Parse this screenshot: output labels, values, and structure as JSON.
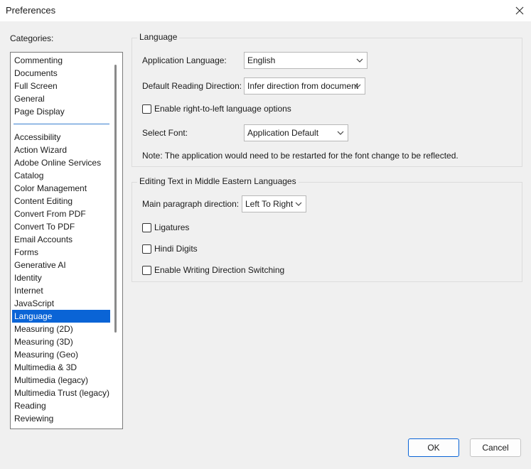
{
  "window": {
    "title": "Preferences"
  },
  "categories": {
    "label": "Categories:",
    "top_group": [
      "Commenting",
      "Documents",
      "Full Screen",
      "General",
      "Page Display"
    ],
    "items": [
      "Accessibility",
      "Action Wizard",
      "Adobe Online Services",
      "Catalog",
      "Color Management",
      "Content Editing",
      "Convert From PDF",
      "Convert To PDF",
      "Email Accounts",
      "Forms",
      "Generative AI",
      "Identity",
      "Internet",
      "JavaScript",
      "Language",
      "Measuring (2D)",
      "Measuring (3D)",
      "Measuring (Geo)",
      "Multimedia & 3D",
      "Multimedia (legacy)",
      "Multimedia Trust (legacy)",
      "Reading",
      "Reviewing"
    ],
    "selected": "Language"
  },
  "language_group": {
    "title": "Language",
    "app_language_label": "Application Language:",
    "app_language_value": "English",
    "reading_direction_label": "Default Reading Direction:",
    "reading_direction_value": "Infer direction from document",
    "rtl_checkbox_label": "Enable right-to-left language options",
    "rtl_checked": false,
    "font_label": "Select Font:",
    "font_value": "Application Default",
    "note": "Note: The application would need to be restarted for the font change to be reflected."
  },
  "middle_east_group": {
    "title": "Editing Text in Middle Eastern Languages",
    "paragraph_direction_label": "Main paragraph direction:",
    "paragraph_direction_value": "Left To Right",
    "ligatures_label": "Ligatures",
    "ligatures_checked": false,
    "hindi_digits_label": "Hindi Digits",
    "hindi_digits_checked": false,
    "writing_direction_label": "Enable Writing Direction Switching",
    "writing_direction_checked": false
  },
  "buttons": {
    "ok": "OK",
    "cancel": "Cancel"
  },
  "colors": {
    "selection": "#0a64d6",
    "background": "#f0f0f0",
    "separator": "#3a7fd0"
  }
}
